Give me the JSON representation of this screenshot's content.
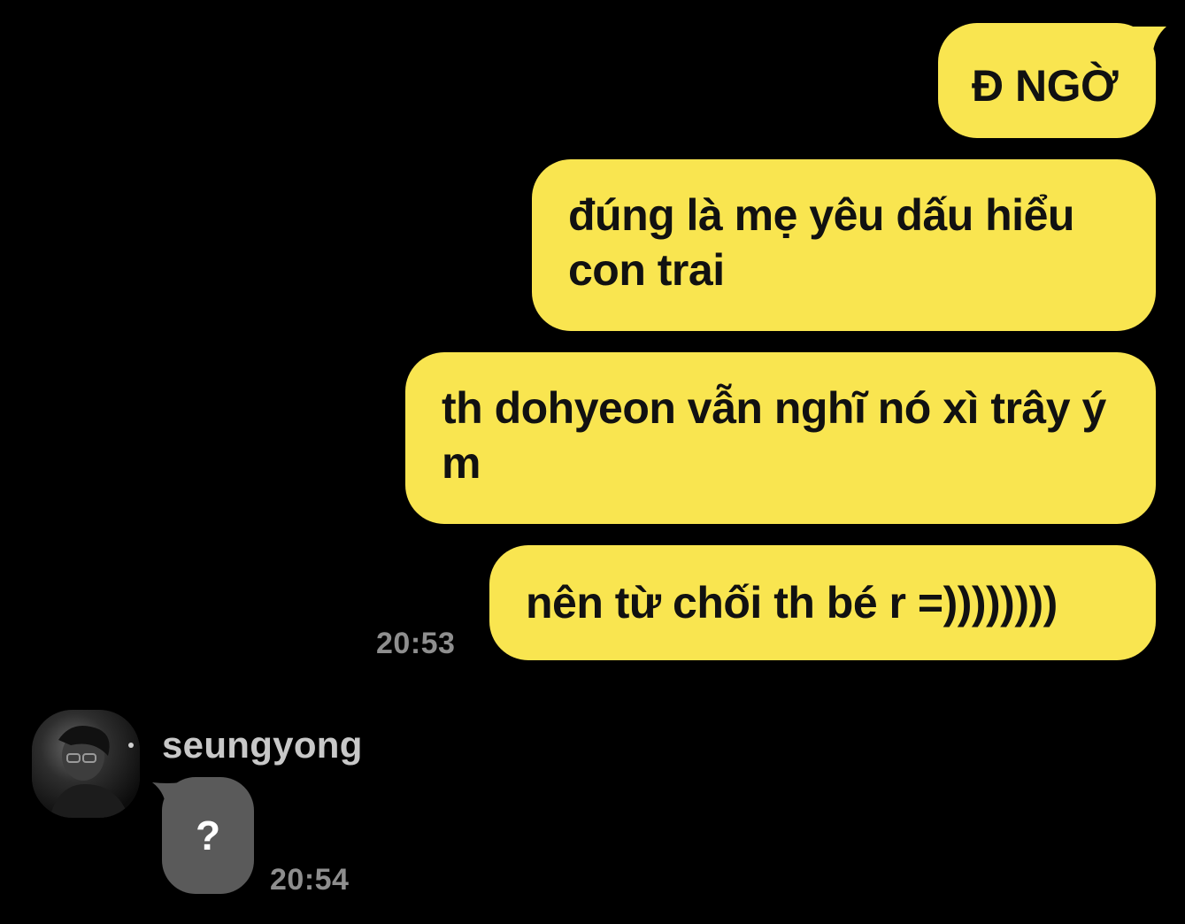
{
  "messages_out": [
    {
      "text": "Đ NGỜ"
    },
    {
      "text": "đúng là mẹ yêu dấu hiểu con trai"
    },
    {
      "text": "th dohyeon vẫn nghĩ nó xì trây ý m"
    },
    {
      "text": "nên từ chối th bé r =))))))))"
    }
  ],
  "out_timestamp": "20:53",
  "incoming": {
    "sender": "seungyong",
    "avatar_icon": "profile-photo-avatar-icon",
    "text": "?",
    "timestamp": "20:54"
  },
  "colors": {
    "background": "#000000",
    "outgoing_bubble": "#F9E550",
    "incoming_bubble": "#5A5A5A",
    "timestamp": "#8E8E8E"
  }
}
